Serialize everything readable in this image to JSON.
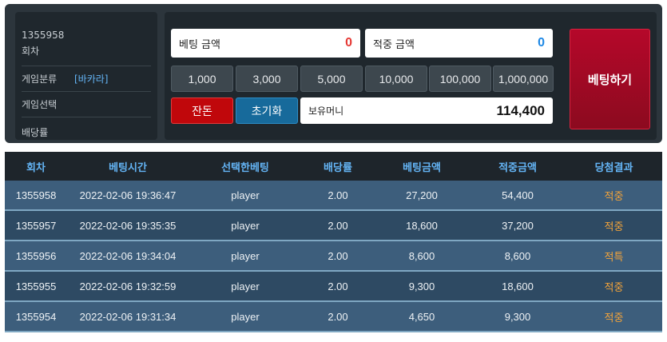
{
  "info": {
    "round_number": "1355958",
    "round_label": "회차",
    "category_label": "게임분류",
    "category_value": "[바카라]",
    "select_label": "게임선택",
    "odds_label": "배당률"
  },
  "bet": {
    "bet_amount_label": "베팅 금액",
    "bet_amount_value": "0",
    "win_amount_label": "적중 금액",
    "win_amount_value": "0",
    "chips": [
      "1,000",
      "3,000",
      "5,000",
      "10,000",
      "100,000",
      "1,000,000"
    ],
    "change_label": "잔돈",
    "reset_label": "초기화",
    "money_label": "보유머니",
    "money_value": "114,400",
    "bet_button_label": "베팅하기"
  },
  "history": {
    "columns": [
      "회차",
      "베팅시간",
      "선택한베팅",
      "배당률",
      "베팅금액",
      "적중금액",
      "당첨결과"
    ],
    "rows": [
      [
        "1355958",
        "2022-02-06 19:36:47",
        "player",
        "2.00",
        "27,200",
        "54,400",
        "적중"
      ],
      [
        "1355957",
        "2022-02-06 19:35:35",
        "player",
        "2.00",
        "18,600",
        "37,200",
        "적중"
      ],
      [
        "1355956",
        "2022-02-06 19:34:04",
        "player",
        "2.00",
        "8,600",
        "8,600",
        "적특"
      ],
      [
        "1355955",
        "2022-02-06 19:32:59",
        "player",
        "2.00",
        "9,300",
        "18,600",
        "적중"
      ],
      [
        "1355954",
        "2022-02-06 19:31:34",
        "player",
        "2.00",
        "4,650",
        "9,300",
        "적중"
      ]
    ]
  },
  "colors": {
    "bet_amount": "#e53935",
    "win_amount": "#1e88e5",
    "result": "#f2a33a",
    "header_text": "#64b5f6"
  }
}
